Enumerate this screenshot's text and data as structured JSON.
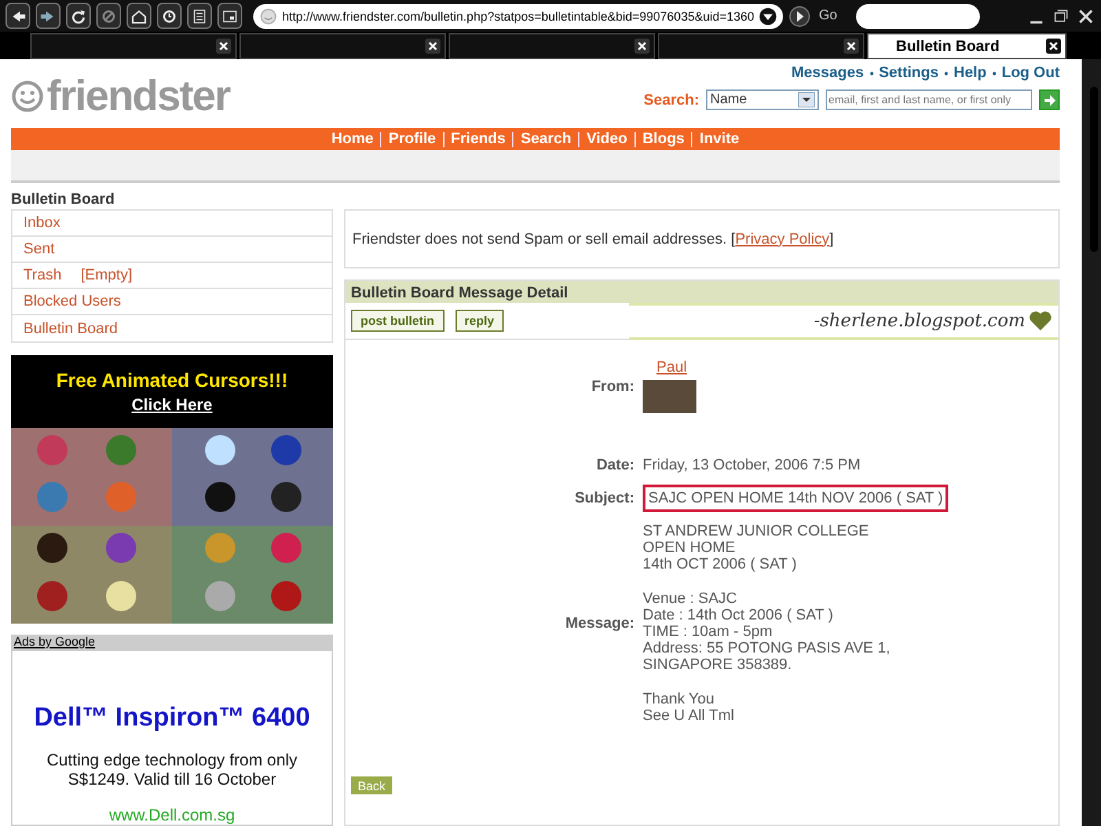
{
  "browser": {
    "address": "http://www.friendster.com/bulletin.php?statpos=bulletintable&bid=99076035&uid=1360",
    "go": "Go",
    "tabs": [
      {
        "selected": false
      },
      {
        "selected": false
      },
      {
        "selected": false
      },
      {
        "selected": false
      },
      {
        "label": "Bulletin Board",
        "selected": true
      }
    ]
  },
  "header": {
    "logo": "friendster",
    "top_links": [
      "Messages",
      "Settings",
      "Help",
      "Log Out"
    ],
    "search_label": "Search:",
    "search_type": "Name",
    "search_placeholder": "email, first and last name, or first only"
  },
  "nav": [
    "Home",
    "Profile",
    "Friends",
    "Search",
    "Video",
    "Blogs",
    "Invite"
  ],
  "sidebar": {
    "title": "Bulletin Board",
    "items": [
      {
        "label": "Inbox"
      },
      {
        "label": "Sent"
      },
      {
        "label": "Trash",
        "action": "[Empty]"
      },
      {
        "label": "Blocked Users"
      },
      {
        "label": "Bulletin Board"
      }
    ]
  },
  "cursor_ad": {
    "title": "Free Animated Cursors!!!",
    "link": "Click Here"
  },
  "google_ad": {
    "header": "Ads by Google",
    "title": "Dell™ Inspiron™ 6400",
    "text": "Cutting edge technology from only S$1249. Valid till 16 October",
    "url": "www.Dell.com.sg"
  },
  "notice": {
    "text": "Friendster does not send Spam or sell email addresses. [",
    "link": "Privacy Policy",
    "after": "]"
  },
  "detail": {
    "title": "Bulletin Board Message Detail",
    "buttons": [
      "post bulletin",
      "reply"
    ],
    "banner": "-sherlene.blogspot.com",
    "from_label": "From:",
    "from_name": "Paul",
    "date_label": "Date:",
    "date": "Friday, 13 October, 2006 7:5 PM",
    "subject_label": "Subject:",
    "subject": "SAJC OPEN HOME 14th NOV 2006 ( SAT )",
    "subject_highlighted": true,
    "message_label": "Message:",
    "message": [
      [
        "ST ANDREW JUNIOR COLLEGE",
        "OPEN HOME",
        "14th OCT 2006 ( SAT )"
      ],
      [
        "Venue : SAJC",
        "Date : 14th Oct 2006 ( SAT )",
        "TIME : 10am - 5pm",
        "Address: 55 POTONG PASIS AVE 1,",
        "SINGAPORE 358389."
      ],
      [
        "Thank You",
        "See U All Tml"
      ]
    ],
    "back": "Back"
  }
}
